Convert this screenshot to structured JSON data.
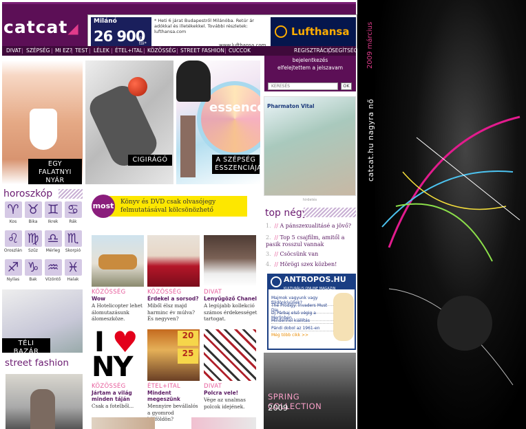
{
  "header": {
    "logo_text": "catcat",
    "banner": {
      "city": "Milánó",
      "price": "26 900",
      "price_unit": "Ft-tól*",
      "text": "* Heti 6 járat Budapestről Milánóba. Retúr ár adókkal és illetékekkel. További részletek: lufthansa.com",
      "url": "www.lufthansa.com",
      "brand": "Lufthansa"
    }
  },
  "nav": {
    "items": [
      "DIVAT",
      "SZÉPSÉG",
      "MI EZ?",
      "TEST",
      "LÉLEK",
      "ÉTEL+ITAL",
      "KÖZÖSSÉG",
      "STREET FASHION",
      "CUCCOK"
    ],
    "register": "REGISZTRÁCIÓ",
    "help": "SEGÍTSÉG"
  },
  "user": {
    "login": "bejelentkezés",
    "forgot": "elfelejtettem a jelszavam",
    "search_placeholder": "KERESÉS",
    "ok_label": "OK"
  },
  "hero": [
    {
      "caption": "EGY FALATNYI NYÁR"
    },
    {
      "caption": "CIGIRÁGÓ"
    },
    {
      "caption": "A SZÉPSÉG ESSZENCIÁJA"
    }
  ],
  "essence_brand": "essence",
  "horoscope": {
    "title": "horoszkóp",
    "signs": [
      {
        "glyph": "♈",
        "name": "Kos"
      },
      {
        "glyph": "♉",
        "name": "Bika"
      },
      {
        "glyph": "♊",
        "name": "Ikrek"
      },
      {
        "glyph": "♋",
        "name": "Rák"
      },
      {
        "glyph": "♌",
        "name": "Oroszlán"
      },
      {
        "glyph": "♍",
        "name": "Szűz"
      },
      {
        "glyph": "♎",
        "name": "Mérleg"
      },
      {
        "glyph": "♏",
        "name": "Skorpió"
      },
      {
        "glyph": "♐",
        "name": "Nyilas"
      },
      {
        "glyph": "♑",
        "name": "Bak"
      },
      {
        "glyph": "♒",
        "name": "Vízöntő"
      },
      {
        "glyph": "♓",
        "name": "Halak"
      }
    ]
  },
  "bazar": {
    "caption": "TÉLI BAZÁR"
  },
  "street_fashion": {
    "title": "street fashion"
  },
  "most": {
    "badge": "most",
    "text": "Könyv és DVD csak olvasójegy felmutatásával kölcsönözhető"
  },
  "cards": [
    {
      "cat": "KÖZÖSSÉG",
      "title": "Wow",
      "desc": "A Hotelicopter lehet álomutazásunk álomeszköze."
    },
    {
      "cat": "KÖZÖSSÉG",
      "title": "Érdekel a sorsod?",
      "desc": "Miből élsz majd harminc év múlva? És negyven?"
    },
    {
      "cat": "DIVAT",
      "title": "Lenyűgöző Chanel",
      "desc": "A legújabb kollekció számos érdekességet tartogat."
    },
    {
      "cat": "KÖZÖSSÉG",
      "title": "Jártam a világ minden táján",
      "desc": "Csak a fotelből..."
    },
    {
      "cat": "ÉTEL+ITAL",
      "title": "Mindent megeszünk",
      "desc": "Mennyire bevállalós a gyomrod külföldön?"
    },
    {
      "cat": "DIVAT",
      "title": "Polcra vele!",
      "desc": "Vége az unalmas polcok idejének."
    }
  ],
  "iny": {
    "text_i": "I",
    "heart": "♥",
    "text_ny": "NY"
  },
  "pharmaton": {
    "brand": "Pharmaton Vital",
    "hirdetes": "hirdetés"
  },
  "top4": {
    "title": "top négy",
    "items": [
      {
        "num": "1.",
        "text": "A pánszexualitásé a jövő?"
      },
      {
        "num": "2.",
        "text": "Top 5 csajfilm, amitől a pasik rosszul vannak"
      },
      {
        "num": "3.",
        "text": "Csöcsünk van"
      },
      {
        "num": "4.",
        "text": "Hörögi szex közben!"
      }
    ]
  },
  "antropos": {
    "title": "ANTROPOS.HU",
    "subtitle": "KULTURÁLIS ONLINE MAGAZIN",
    "links": [
      "Majmok vagyunk vagy földönkívüliek?",
      "The Prodigy: Invaders Must Die",
      "Dj Párbaj első végig a Merlinben",
      "Mindenhol kiállítás",
      "Pándi dobol az 1961-en"
    ],
    "more": "Még több cikk >>"
  },
  "spring": {
    "line1": "SPRING COLLECTION",
    "line2": "2009"
  },
  "side": {
    "vertical": "catcat.hu  nagyra nő",
    "issue": "2009 március"
  }
}
